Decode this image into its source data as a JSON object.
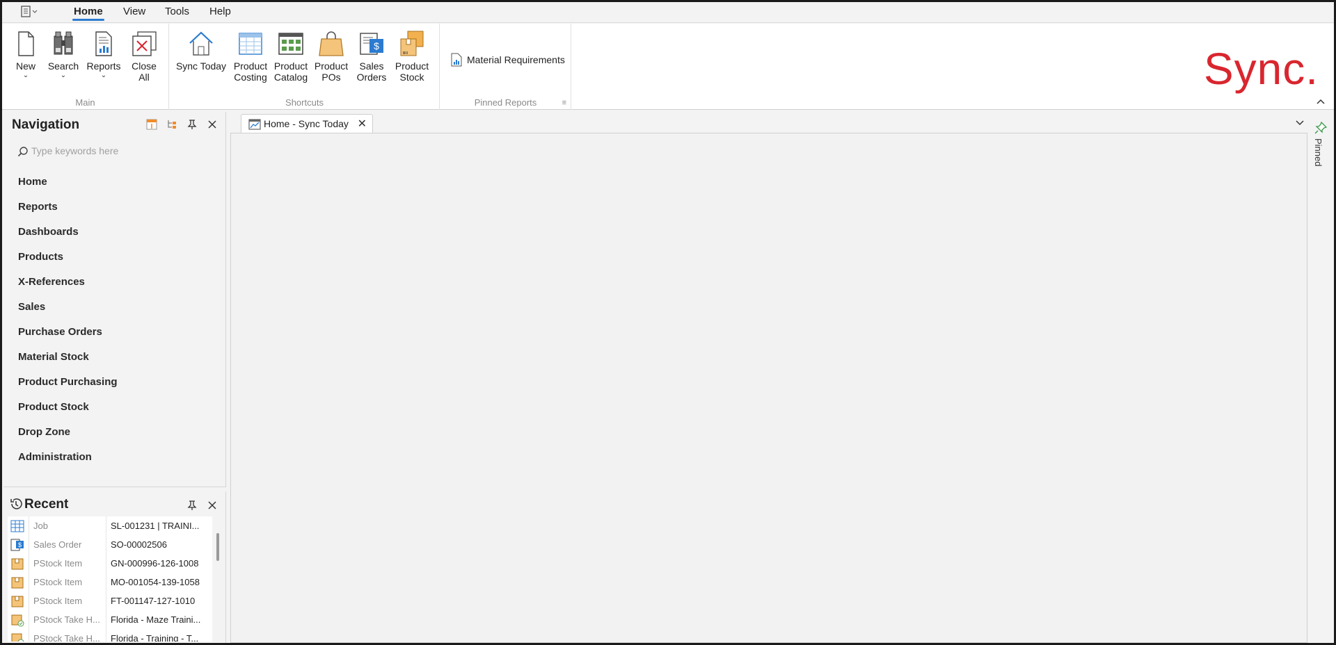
{
  "menubar": {
    "tabs": [
      "Home",
      "View",
      "Tools",
      "Help"
    ],
    "active": "Home"
  },
  "ribbon": {
    "main": {
      "caption": "Main",
      "buttons": [
        {
          "label": "New",
          "icon": "new-document-icon",
          "dropdown": true
        },
        {
          "label": "Search",
          "icon": "binoculars-icon",
          "dropdown": true
        },
        {
          "label": "Reports",
          "icon": "report-icon",
          "dropdown": true
        },
        {
          "label": "Close All",
          "icon": "close-all-icon",
          "dropdown": false
        }
      ]
    },
    "shortcuts": {
      "caption": "Shortcuts",
      "buttons": [
        {
          "label": "Sync Today",
          "icon": "house-icon"
        },
        {
          "label": "Product Costing",
          "icon": "spreadsheet-icon"
        },
        {
          "label": "Product Catalog",
          "icon": "catalog-icon"
        },
        {
          "label": "Product POs",
          "icon": "shopping-bag-icon"
        },
        {
          "label": "Sales Orders",
          "icon": "sales-order-icon"
        },
        {
          "label": "Product Stock",
          "icon": "boxes-icon"
        }
      ]
    },
    "pinned_reports": {
      "caption": "Pinned Reports",
      "items": [
        "Material Requirements"
      ]
    },
    "logo": "Sync."
  },
  "navigation": {
    "title": "Navigation",
    "search_placeholder": "Type keywords here",
    "items": [
      "Home",
      "Reports",
      "Dashboards",
      "Products",
      "X-References",
      "Sales",
      "Purchase Orders",
      "Material Stock",
      "Product Purchasing",
      "Product Stock",
      "Drop Zone",
      "Administration"
    ]
  },
  "recent": {
    "title": "Recent",
    "rows": [
      {
        "type": "Job",
        "value": "SL-001231 | TRAINI...",
        "icon": "job-grid-icon"
      },
      {
        "type": "Sales Order",
        "value": "SO-00002506",
        "icon": "sales-order-icon"
      },
      {
        "type": "PStock Item",
        "value": "GN-000996-126-1008",
        "icon": "stock-box-icon"
      },
      {
        "type": "PStock Item",
        "value": "MO-001054-139-1058",
        "icon": "stock-box-icon"
      },
      {
        "type": "PStock Item",
        "value": "FT-001147-127-1010",
        "icon": "stock-box-icon"
      },
      {
        "type": "PStock Take H...",
        "value": "Florida - Maze Traini...",
        "icon": "stock-take-icon"
      },
      {
        "type": "PStock Take H...",
        "value": "Florida - Training - T...",
        "icon": "stock-take-icon"
      }
    ]
  },
  "document": {
    "tab_label": "Home - Sync Today",
    "pinned_label": "Pinned"
  },
  "colors": {
    "accent": "#2b7bd0",
    "brand": "#d9262f"
  }
}
